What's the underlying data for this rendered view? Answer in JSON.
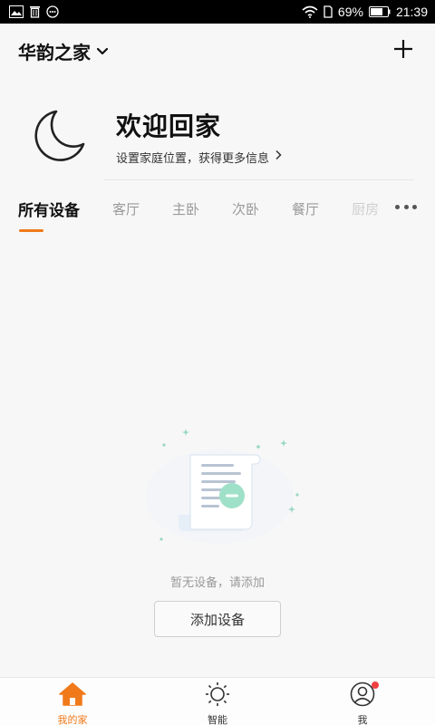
{
  "status_bar": {
    "battery": "69%",
    "time": "21:39"
  },
  "header": {
    "home_name": "华韵之家"
  },
  "welcome": {
    "title": "欢迎回家",
    "subtitle": "设置家庭位置，获得更多信息"
  },
  "tabs": [
    {
      "label": "所有设备",
      "active": true
    },
    {
      "label": "客厅"
    },
    {
      "label": "主卧"
    },
    {
      "label": "次卧"
    },
    {
      "label": "餐厅"
    },
    {
      "label": "厨房"
    }
  ],
  "empty_state": {
    "message": "暂无设备，请添加",
    "button_label": "添加设备"
  },
  "bottom_nav": [
    {
      "label": "我的家",
      "icon": "home-icon",
      "active": true
    },
    {
      "label": "智能",
      "icon": "sun-icon"
    },
    {
      "label": "我",
      "icon": "user-icon",
      "badge": true
    }
  ],
  "colors": {
    "accent": "#f07a1a",
    "badge": "#f04040",
    "background": "#f7f7f7"
  }
}
